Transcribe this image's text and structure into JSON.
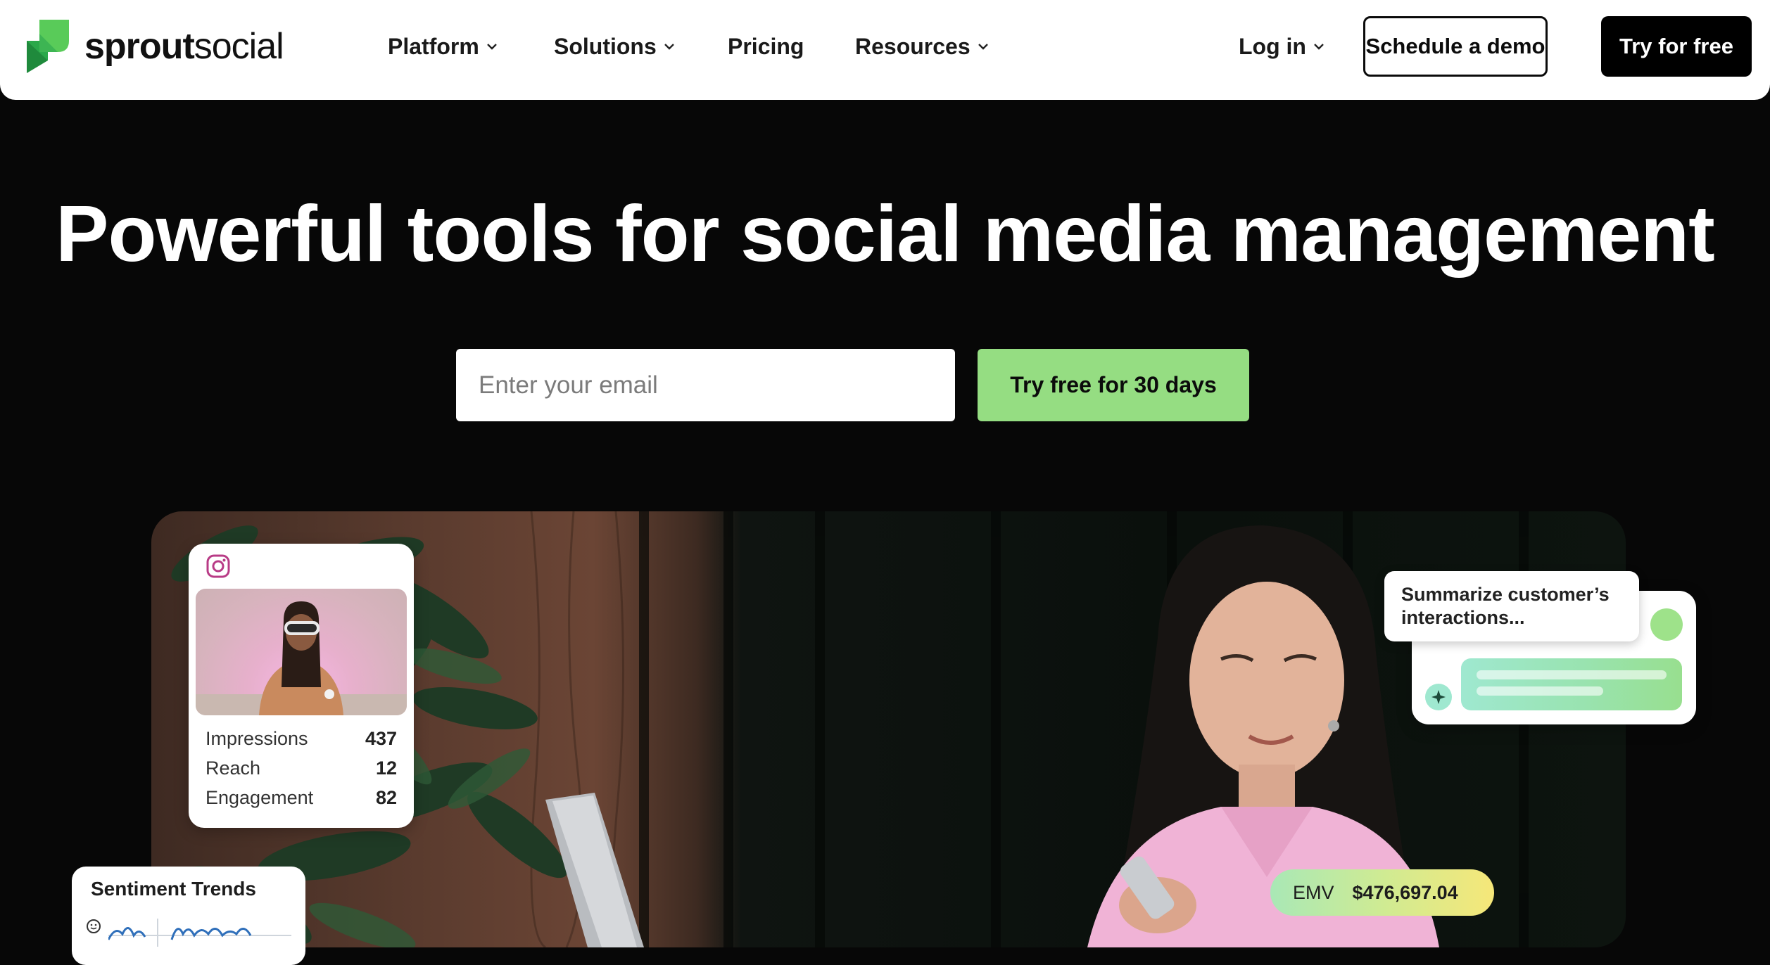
{
  "header": {
    "logo_text_bold": "sprout",
    "logo_text_regular": "social",
    "nav": [
      {
        "label": "Platform",
        "has_dropdown": true
      },
      {
        "label": "Solutions",
        "has_dropdown": true
      },
      {
        "label": "Pricing",
        "has_dropdown": false
      },
      {
        "label": "Resources",
        "has_dropdown": true
      }
    ],
    "login_label": "Log in",
    "demo_label": "Schedule a demo",
    "try_label": "Try for free"
  },
  "hero": {
    "title": "Powerful tools for social media management",
    "email_placeholder": "Enter your email",
    "cta_label": "Try free for 30 days"
  },
  "instagram_card": {
    "icon": "instagram-icon",
    "stats": [
      {
        "label": "Impressions",
        "value": "437"
      },
      {
        "label": "Reach",
        "value": "12"
      },
      {
        "label": "Engagement",
        "value": "82"
      }
    ]
  },
  "sentiment_card": {
    "title": "Sentiment Trends",
    "icon": "smiley-icon"
  },
  "ai_card": {
    "prompt": "Summarize customer’s interactions...",
    "icon": "sparkle-icon"
  },
  "emv": {
    "label": "EMV",
    "value": "$476,697.04"
  },
  "colors": {
    "brand_green": "#59cb59",
    "cta_green": "#95dd82",
    "background": "#070707"
  }
}
